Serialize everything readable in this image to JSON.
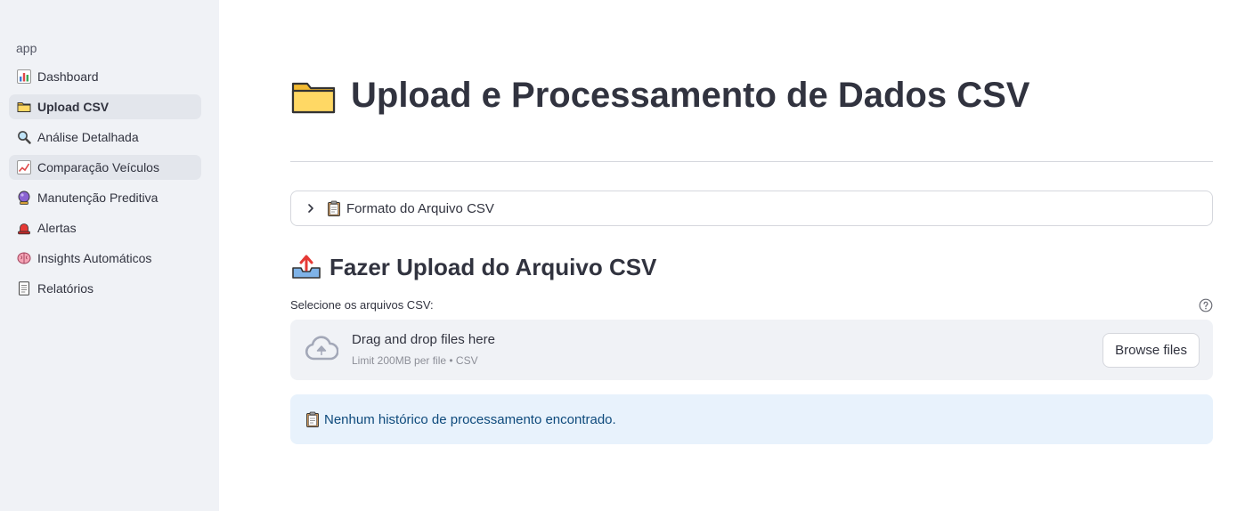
{
  "sidebar": {
    "app_label": "app",
    "items": [
      {
        "label": "Dashboard",
        "icon": "bar-chart-icon"
      },
      {
        "label": "Upload CSV",
        "icon": "folder-icon",
        "active": true
      },
      {
        "label": "Análise Detalhada",
        "icon": "magnifier-icon"
      },
      {
        "label": "Comparação Veículos",
        "icon": "line-chart-icon"
      },
      {
        "label": "Manutenção Preditiva",
        "icon": "crystal-ball-icon"
      },
      {
        "label": "Alertas",
        "icon": "siren-icon"
      },
      {
        "label": "Insights Automáticos",
        "icon": "brain-icon"
      },
      {
        "label": "Relatórios",
        "icon": "page-icon"
      }
    ]
  },
  "main": {
    "title": "Upload e Processamento de Dados CSV",
    "expander_label": "Formato do Arquivo CSV",
    "upload_heading": "Fazer Upload do Arquivo CSV",
    "uploader": {
      "label": "Selecione os arquivos CSV:",
      "drop_title": "Drag and drop files here",
      "drop_subtitle": "Limit 200MB per file • CSV",
      "browse_label": "Browse files"
    },
    "info_message": "Nenhum histórico de processamento encontrado."
  },
  "colors": {
    "sidebar_bg": "#f0f2f6",
    "info_bg": "#e8f2fc",
    "info_text": "#0e4a7c",
    "text": "#31333f"
  }
}
